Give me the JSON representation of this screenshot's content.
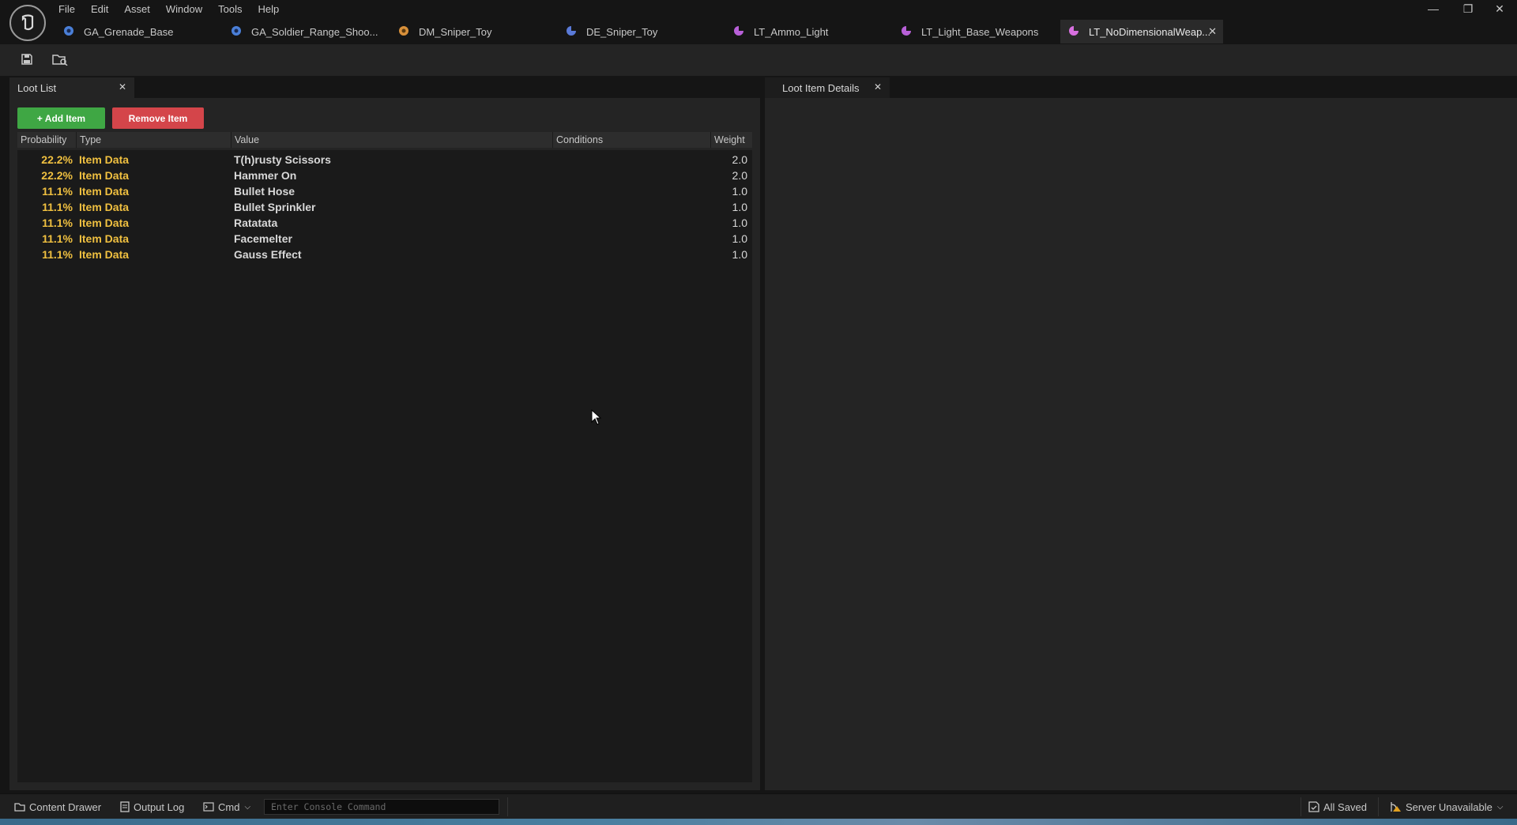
{
  "menu": [
    "File",
    "Edit",
    "Asset",
    "Window",
    "Tools",
    "Help"
  ],
  "asset_tabs": [
    {
      "label": "GA_Grenade_Base",
      "icon": "blueprint-icon",
      "color": "#4a7fd8"
    },
    {
      "label": "GA_Soldier_Range_Shoo...",
      "icon": "blueprint-icon",
      "color": "#4a7fd8"
    },
    {
      "label": "DM_Sniper_Toy",
      "icon": "data-asset-icon",
      "color": "#d8903a"
    },
    {
      "label": "DE_Sniper_Toy",
      "icon": "data-asset-icon",
      "color": "#5a7ad8"
    },
    {
      "label": "LT_Ammo_Light",
      "icon": "loot-table-icon",
      "color": "#b860d8"
    },
    {
      "label": "LT_Light_Base_Weapons",
      "icon": "loot-table-icon",
      "color": "#b860d8"
    },
    {
      "label": "LT_NoDimensionalWeap...",
      "icon": "loot-table-icon",
      "color": "#d870e0",
      "active": true
    }
  ],
  "loot_list": {
    "tab_label": "Loot List",
    "add_label": "+ Add Item",
    "remove_label": "Remove Item",
    "columns": [
      "Probability",
      "Type",
      "Value",
      "Conditions",
      "Weight"
    ],
    "rows": [
      {
        "probability": "22.2%",
        "type": "Item Data",
        "value": "T(h)rusty Scissors",
        "weight": "2.0"
      },
      {
        "probability": "22.2%",
        "type": "Item Data",
        "value": "Hammer On",
        "weight": "2.0"
      },
      {
        "probability": "11.1%",
        "type": "Item Data",
        "value": "Bullet Hose",
        "weight": "1.0"
      },
      {
        "probability": "11.1%",
        "type": "Item Data",
        "value": "Bullet Sprinkler",
        "weight": "1.0"
      },
      {
        "probability": "11.1%",
        "type": "Item Data",
        "value": "Ratatata",
        "weight": "1.0"
      },
      {
        "probability": "11.1%",
        "type": "Item Data",
        "value": "Facemelter",
        "weight": "1.0"
      },
      {
        "probability": "11.1%",
        "type": "Item Data",
        "value": "Gauss Effect",
        "weight": "1.0"
      }
    ]
  },
  "details": {
    "tab_label": "Loot Item Details"
  },
  "statusbar": {
    "content_drawer": "Content Drawer",
    "output_log": "Output Log",
    "cmd": "Cmd",
    "console_placeholder": "Enter Console Command",
    "all_saved": "All Saved",
    "server": "Server Unavailable"
  },
  "colors": {
    "add": "#3fa744",
    "remove": "#d4454a",
    "accent_text": "#f0c040"
  }
}
